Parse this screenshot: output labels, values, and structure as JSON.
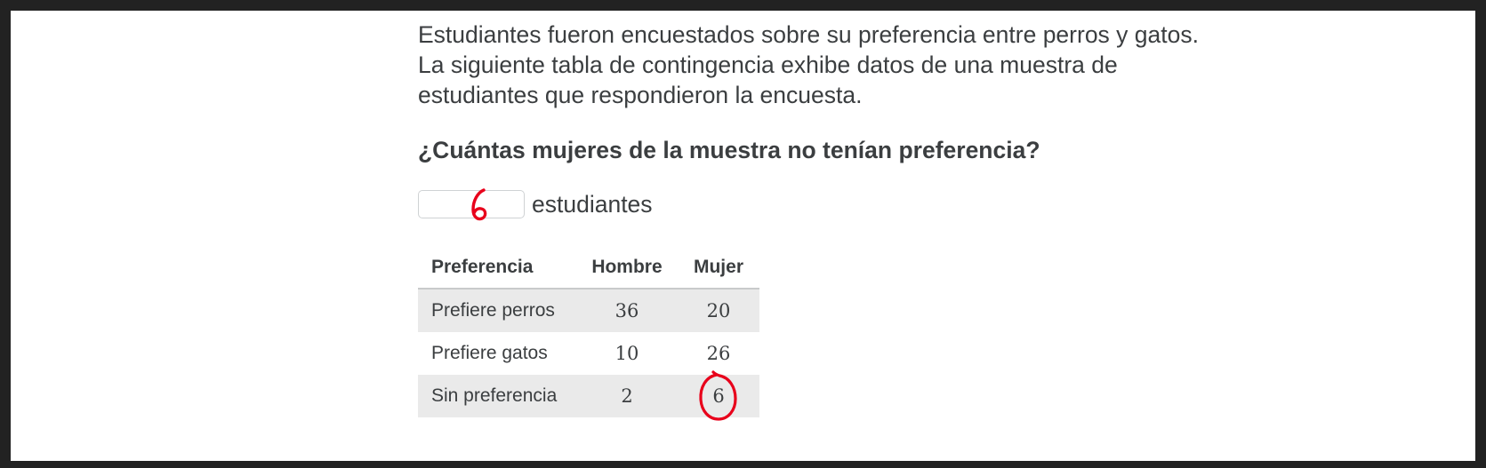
{
  "intro_lines": [
    "Estudiantes fueron encuestados sobre su preferencia entre perros y gatos.",
    "La siguiente tabla de contingencia exhibe datos de una muestra de",
    "estudiantes que respondieron la encuesta."
  ],
  "question": "¿Cuántas mujeres de la muestra no tenían preferencia?",
  "answer": {
    "value": "6",
    "unit": "estudiantes"
  },
  "table": {
    "headers": [
      "Preferencia",
      "Hombre",
      "Mujer"
    ],
    "rows": [
      {
        "label": "Prefiere perros",
        "hombre": "36",
        "mujer": "20"
      },
      {
        "label": "Prefiere gatos",
        "hombre": "10",
        "mujer": "26"
      },
      {
        "label": "Sin preferencia",
        "hombre": "2",
        "mujer": "6"
      }
    ]
  },
  "annotation": {
    "ink_color": "#e8001b",
    "circled_cell": "Sin preferencia / Mujer"
  }
}
